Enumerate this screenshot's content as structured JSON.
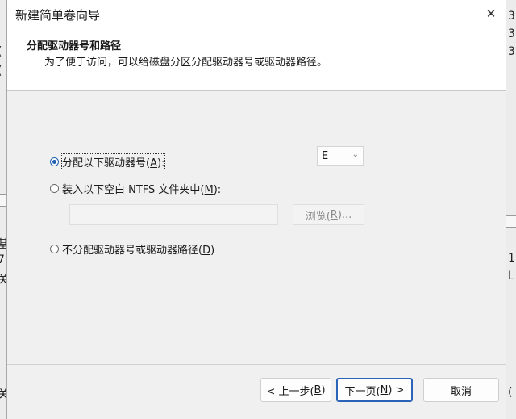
{
  "window": {
    "title": "新建简单卷向导",
    "close_glyph": "✕"
  },
  "header": {
    "title": "分配驱动器号和路径",
    "subtitle": "为了便于访问，可以给磁盘分区分配驱动器号或驱动器路径。"
  },
  "options": {
    "assign_letter": {
      "label_pre": "分配以下驱动器号(",
      "key": "A",
      "label_post": "):",
      "checked": true
    },
    "mount_folder": {
      "label_pre": "装入以下空白 NTFS 文件夹中(",
      "key": "M",
      "label_post": "):",
      "checked": false
    },
    "no_assign": {
      "label_pre": "不分配驱动器号或驱动器路径(",
      "key": "D",
      "label_post": ")",
      "checked": false
    }
  },
  "drive_letter": {
    "value": "E",
    "chevron": "⌄"
  },
  "folder_path": {
    "value": ""
  },
  "browse": {
    "label_pre": "浏览(",
    "key": "R",
    "label_post": ")..."
  },
  "footer": {
    "back": {
      "label_pre": "< 上一步(",
      "key": "B",
      "label_post": ")"
    },
    "next": {
      "label_pre": "下一页(",
      "key": "N",
      "label_post": ") >"
    },
    "cancel": {
      "label": "取消"
    }
  },
  "background_fragments": {
    "left": [
      "(",
      "(",
      "基",
      "7",
      "关",
      "关"
    ],
    "right": [
      "3",
      "3",
      "3",
      "1",
      "L",
      "("
    ]
  }
}
